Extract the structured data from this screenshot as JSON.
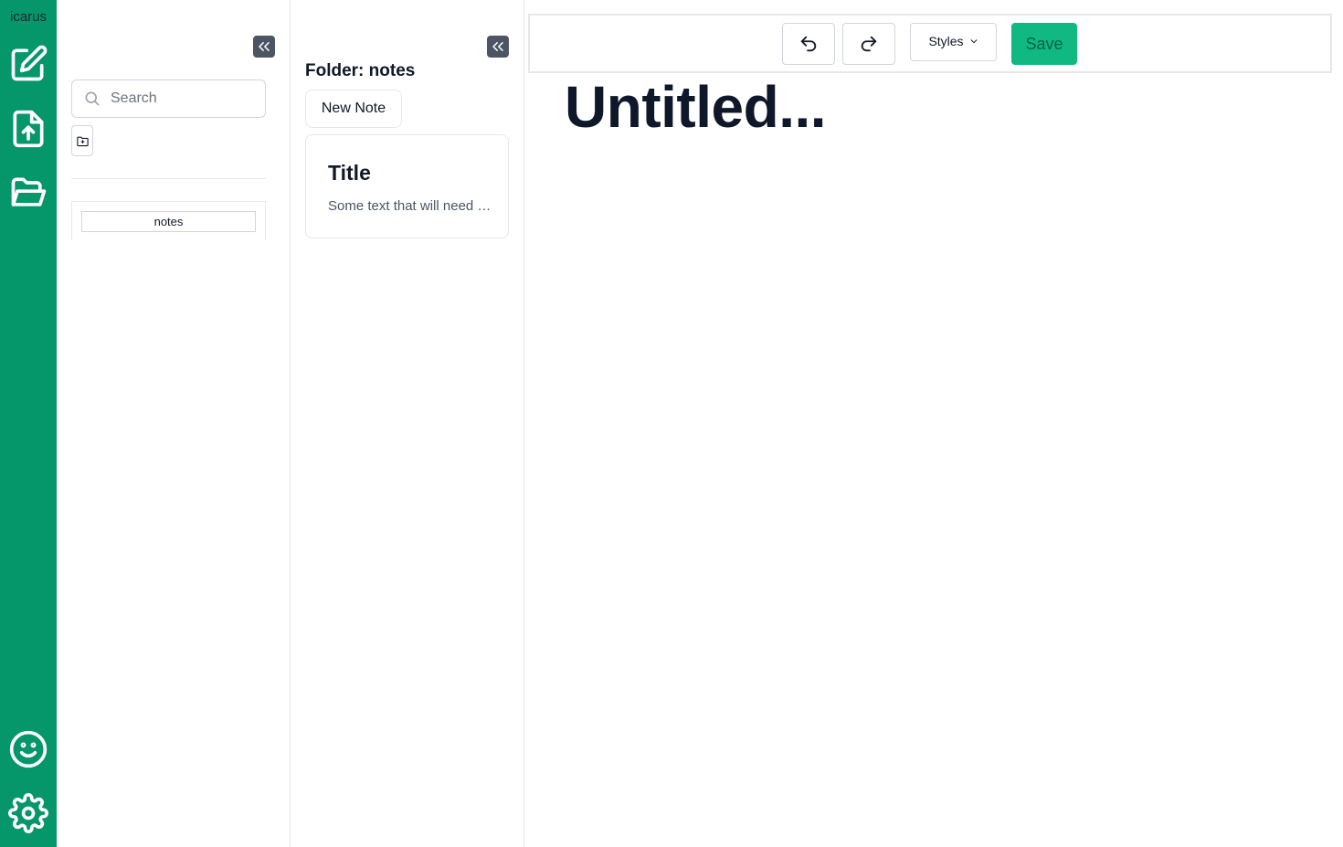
{
  "app": {
    "name": "icarus"
  },
  "rail": {
    "items": [
      {
        "icon": "edit-icon"
      },
      {
        "icon": "file-upload-icon"
      },
      {
        "icon": "folder-open-icon"
      },
      {
        "icon": "smiley-icon"
      },
      {
        "icon": "gear-icon"
      }
    ]
  },
  "folders_panel": {
    "search": {
      "placeholder": "Search",
      "value": ""
    },
    "folders": [
      {
        "label": "notes"
      }
    ]
  },
  "notes_panel": {
    "folder_title": "Folder: notes",
    "new_note_label": "New Note",
    "notes": [
      {
        "title": "Title",
        "preview": "Some text that will need to be shortened"
      }
    ]
  },
  "editor": {
    "styles_label": "Styles",
    "save_label": "Save",
    "document_title": "Untitled..."
  },
  "colors": {
    "rail": "#059669",
    "save": "#10b981",
    "collapse": "#4b5563"
  }
}
